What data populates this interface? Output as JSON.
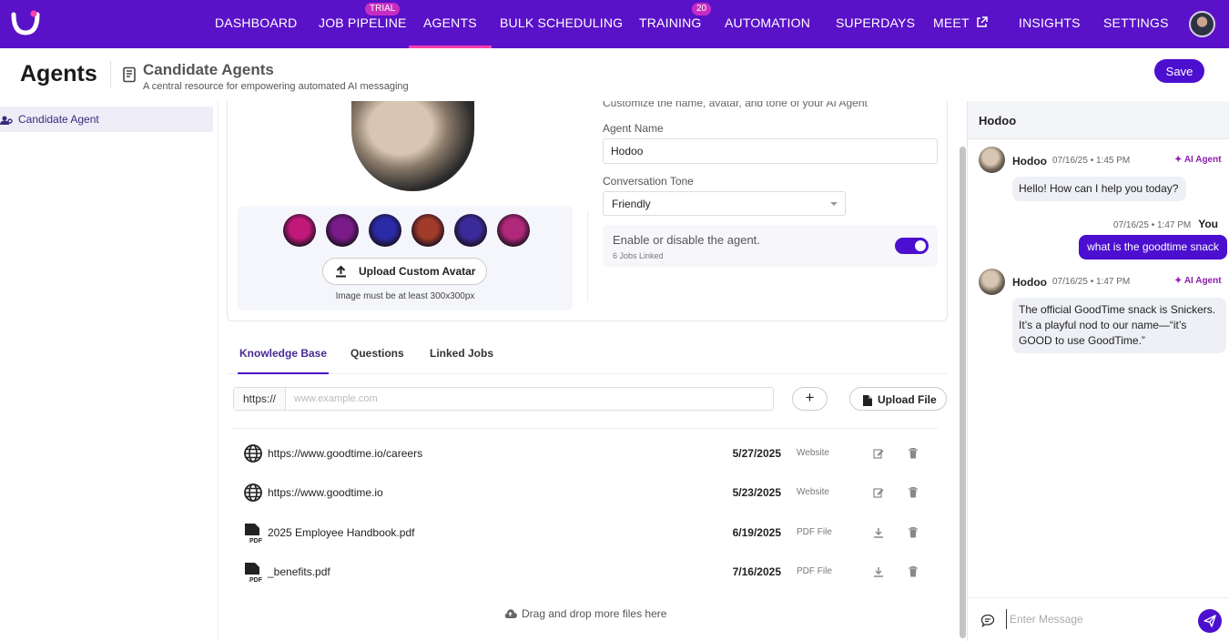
{
  "nav": {
    "items": [
      {
        "label": "DASHBOARD"
      },
      {
        "label": "JOB PIPELINE",
        "badge": "TRIAL"
      },
      {
        "label": "AGENTS",
        "active": true
      },
      {
        "label": "BULK SCHEDULING"
      },
      {
        "label": "TRAINING",
        "badge": "20"
      },
      {
        "label": "AUTOMATION"
      },
      {
        "label": "SUPERDAYS"
      },
      {
        "label": "MEET"
      },
      {
        "label": "INSIGHTS"
      },
      {
        "label": "SETTINGS"
      }
    ],
    "logo_icon": "goodtime-logo-icon",
    "meet_icon": "external-link-icon"
  },
  "header": {
    "title": "Agents",
    "subtitle": "Candidate Agents",
    "description": "A central resource for empowering automated AI messaging",
    "save_label": "Save"
  },
  "sidebar": {
    "items": [
      {
        "label": "Candidate Agent",
        "icon": "agent-settings-icon"
      }
    ]
  },
  "agent": {
    "customize_text": "Customize the name, avatar, and tone of your AI Agent",
    "name_label": "Agent Name",
    "name_value": "Hodoo",
    "tone_label": "Conversation Tone",
    "tone_value": "Friendly",
    "toggle_label": "Enable or disable the agent.",
    "toggle_sub": "6 Jobs Linked",
    "enabled": true,
    "upload_avatar_label": "Upload Custom Avatar",
    "avatar_hint": "Image must be at least 300x300px",
    "avatar_options": [
      "#c2187a",
      "#7a1b8a",
      "#2a2aa8",
      "#a13b2a",
      "#3b2a9a",
      "#b0287a"
    ]
  },
  "tabs": [
    {
      "label": "Knowledge Base",
      "active": true
    },
    {
      "label": "Questions"
    },
    {
      "label": "Linked Jobs"
    }
  ],
  "kb": {
    "url_prefix": "https://",
    "url_placeholder": "www.example.com",
    "add_label": "+",
    "upload_label": "Upload File",
    "items": [
      {
        "name": "https://www.goodtime.io/careers",
        "date": "5/27/2025",
        "type": "Website",
        "icon": "globe-icon",
        "action": "edit-icon"
      },
      {
        "name": "https://www.goodtime.io",
        "date": "5/23/2025",
        "type": "Website",
        "icon": "globe-icon",
        "action": "edit-icon"
      },
      {
        "name": "2025 Employee Handbook.pdf",
        "date": "6/19/2025",
        "type": "PDF File",
        "icon": "pdf-file-icon",
        "action": "download-icon"
      },
      {
        "name": "_benefits.pdf",
        "date": "7/16/2025",
        "type": "PDF File",
        "icon": "pdf-file-icon",
        "action": "download-icon"
      }
    ],
    "drag_drop_label": "Drag and drop more files here"
  },
  "chat": {
    "title": "Hodoo",
    "messages": [
      {
        "sender": "Hodoo",
        "time": "07/16/25 • 1:45 PM",
        "tag": "AI Agent",
        "text": "Hello! How can I help you today?"
      },
      {
        "sender": "You",
        "time": "07/16/25 • 1:47 PM",
        "text": "what is the goodtime snack"
      },
      {
        "sender": "Hodoo",
        "time": "07/16/25 • 1:47 PM",
        "tag": "AI Agent",
        "text": "The official GoodTime snack is Snickers. It’s a playful nod to our name—“it’s GOOD to use GoodTime.”"
      }
    ],
    "input_placeholder": "Enter Message"
  },
  "colors": {
    "nav_bg": "#5a12c8",
    "accent": "#4c0fcf",
    "badge": "#c62dc2",
    "active_underline": "#ff3fae"
  }
}
